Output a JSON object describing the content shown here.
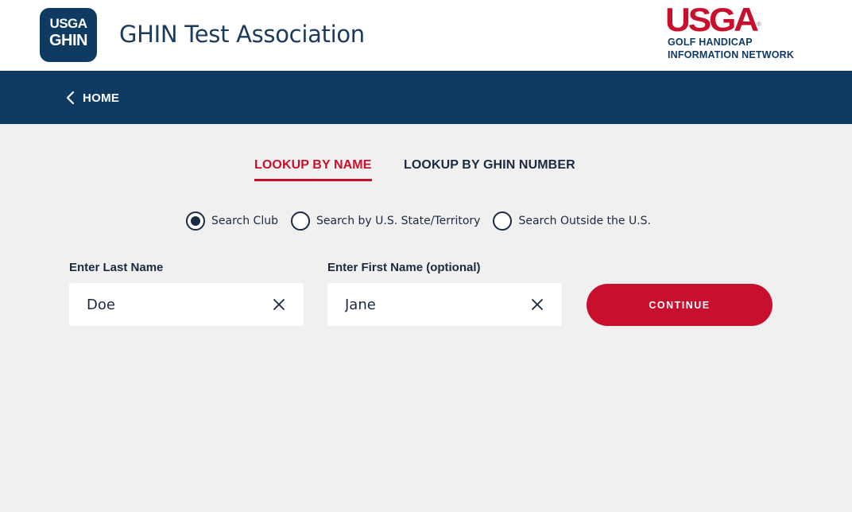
{
  "header": {
    "app_logo": {
      "line1": "USGA",
      "line2": "GHIN"
    },
    "association_title": "GHIN Test Association",
    "brand": {
      "mark": "USGA",
      "registered": "®",
      "line1": "GOLF HANDICAP",
      "line2": "INFORMATION NETWORK"
    }
  },
  "nav": {
    "back_icon": "chevron-left-icon",
    "back_label": "HOME"
  },
  "tabs": [
    {
      "label": "LOOKUP BY NAME",
      "active": true
    },
    {
      "label": "LOOKUP BY GHIN NUMBER",
      "active": false
    }
  ],
  "search_scope": {
    "options": [
      {
        "label": "Search Club",
        "checked": true
      },
      {
        "label": "Search by U.S. State/Territory",
        "checked": false
      },
      {
        "label": "Search Outside the U.S.",
        "checked": false
      }
    ]
  },
  "form": {
    "last_name": {
      "label": "Enter Last Name",
      "value": "Doe",
      "clear_icon": "close-icon"
    },
    "first_name": {
      "label": "Enter First Name (optional)",
      "value": "Jane",
      "clear_icon": "close-icon"
    },
    "continue_label": "CONTINUE"
  },
  "colors": {
    "navy": "#0f3a62",
    "red": "#c8102e",
    "background": "#f0f0f0"
  }
}
